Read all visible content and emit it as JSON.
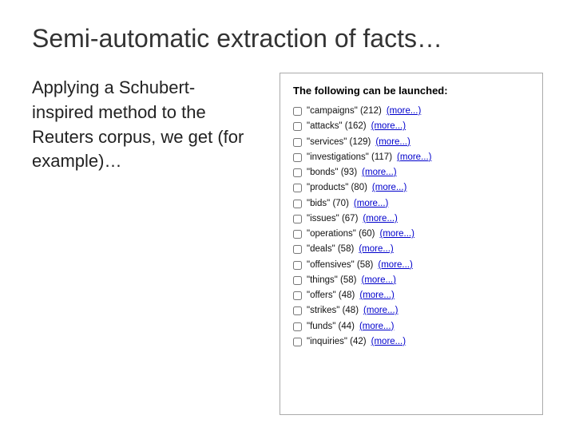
{
  "title": "Semi-automatic extraction of facts…",
  "left_text": "Applying a Schubert-inspired method to the Reuters corpus, we get (for example)…",
  "panel": {
    "heading": "The following can be launched:",
    "items": [
      {
        "label": "\"campaigns\" (212)",
        "more": "(more...)"
      },
      {
        "label": "\"attacks\" (162)",
        "more": "(more...)"
      },
      {
        "label": "\"services\" (129)",
        "more": "(more...)"
      },
      {
        "label": "\"investigations\" (117)",
        "more": "(more...)"
      },
      {
        "label": "\"bonds\" (93)",
        "more": "(more...)"
      },
      {
        "label": "\"products\" (80)",
        "more": "(more...)"
      },
      {
        "label": "\"bids\" (70)",
        "more": "(more...)"
      },
      {
        "label": "\"issues\" (67)",
        "more": "(more...)"
      },
      {
        "label": "\"operations\" (60)",
        "more": "(more...)"
      },
      {
        "label": "\"deals\" (58)",
        "more": "(more...)"
      },
      {
        "label": "\"offensives\" (58)",
        "more": "(more...)"
      },
      {
        "label": "\"things\" (58)",
        "more": "(more...)"
      },
      {
        "label": "\"offers\" (48)",
        "more": "(more...)"
      },
      {
        "label": "\"strikes\" (48)",
        "more": "(more...)"
      },
      {
        "label": "\"funds\" (44)",
        "more": "(more...)"
      },
      {
        "label": "\"inquiries\" (42)",
        "more": "(more...)"
      }
    ]
  }
}
